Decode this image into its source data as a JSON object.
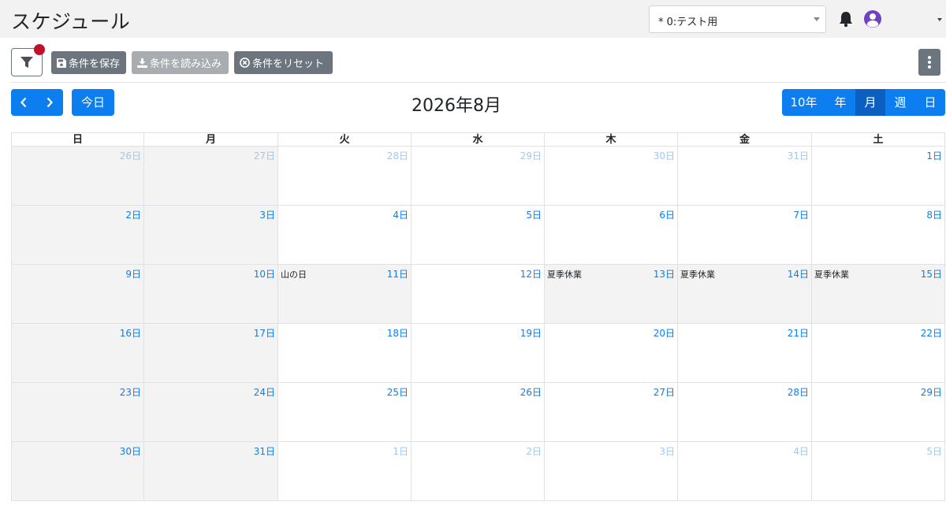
{
  "header": {
    "title": "スケジュール",
    "select_value": "* 0:テスト用"
  },
  "toolbar": {
    "save_label": "条件を保存",
    "load_label": "条件を読み込み",
    "reset_label": "条件をリセット"
  },
  "calendar_nav": {
    "today_label": "今日",
    "title": "2026年8月",
    "views": [
      "10年",
      "年",
      "月",
      "週",
      "日"
    ],
    "active_view": "月"
  },
  "weekdays": [
    "日",
    "月",
    "火",
    "水",
    "木",
    "金",
    "土"
  ],
  "weeks": [
    [
      {
        "day": "26日",
        "other": true,
        "gray": true
      },
      {
        "day": "27日",
        "other": true,
        "gray": true
      },
      {
        "day": "28日",
        "other": true
      },
      {
        "day": "29日",
        "other": true
      },
      {
        "day": "30日",
        "other": true
      },
      {
        "day": "31日",
        "other": true
      },
      {
        "day": "1日"
      }
    ],
    [
      {
        "day": "2日",
        "gray": true
      },
      {
        "day": "3日",
        "gray": true
      },
      {
        "day": "4日"
      },
      {
        "day": "5日"
      },
      {
        "day": "6日"
      },
      {
        "day": "7日"
      },
      {
        "day": "8日"
      }
    ],
    [
      {
        "day": "9日",
        "gray": true
      },
      {
        "day": "10日",
        "gray": true
      },
      {
        "day": "11日",
        "gray": true,
        "event": "山の日"
      },
      {
        "day": "12日"
      },
      {
        "day": "13日",
        "gray": true,
        "event": "夏季休業"
      },
      {
        "day": "14日",
        "gray": true,
        "event": "夏季休業"
      },
      {
        "day": "15日",
        "gray": true,
        "event": "夏季休業"
      }
    ],
    [
      {
        "day": "16日",
        "gray": true
      },
      {
        "day": "17日",
        "gray": true
      },
      {
        "day": "18日"
      },
      {
        "day": "19日"
      },
      {
        "day": "20日"
      },
      {
        "day": "21日"
      },
      {
        "day": "22日"
      }
    ],
    [
      {
        "day": "23日",
        "gray": true
      },
      {
        "day": "24日",
        "gray": true
      },
      {
        "day": "25日"
      },
      {
        "day": "26日"
      },
      {
        "day": "27日"
      },
      {
        "day": "28日"
      },
      {
        "day": "29日"
      }
    ],
    [
      {
        "day": "30日",
        "gray": true
      },
      {
        "day": "31日",
        "gray": true
      },
      {
        "day": "1日",
        "other": true
      },
      {
        "day": "2日",
        "other": true
      },
      {
        "day": "3日",
        "other": true
      },
      {
        "day": "4日",
        "other": true
      },
      {
        "day": "5日",
        "other": true
      }
    ]
  ],
  "colors": {
    "primary": "#0d7ef0",
    "primary_active": "#0b5fc0",
    "secondary": "#6c757d",
    "badge": "#c0102a",
    "avatar": "#6f42c1"
  }
}
